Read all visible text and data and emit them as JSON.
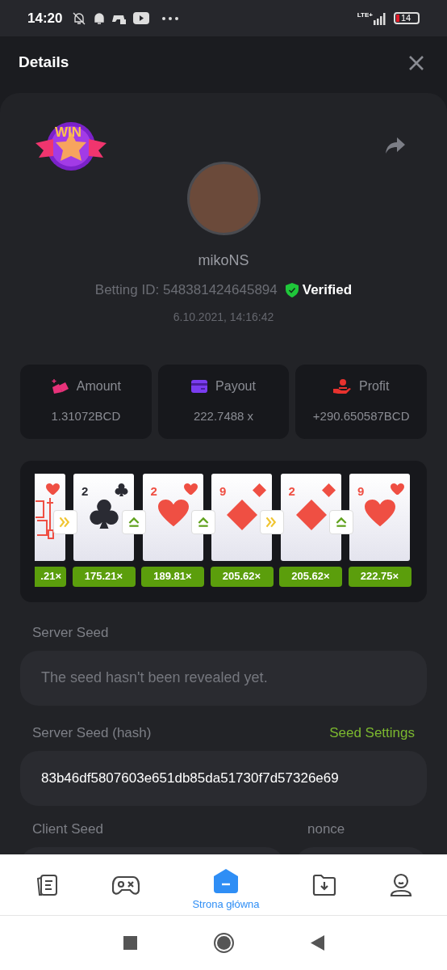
{
  "status_bar": {
    "time": "14:20",
    "network": "LTE+",
    "battery": "14"
  },
  "header": {
    "title": "Details"
  },
  "bet": {
    "username": "mikoNS",
    "betting_id": "Betting ID: 548381424645894",
    "verified": "Verified",
    "date": "6.10.2021, 14:16:42"
  },
  "stats": [
    {
      "kind": "amount",
      "label": "Amount",
      "value": "1.31072BCD"
    },
    {
      "kind": "payout",
      "label": "Payout",
      "value": "222.7488 x"
    },
    {
      "kind": "profit",
      "label": "Profit",
      "value": "+290.650587BCD"
    }
  ],
  "win_badge": {
    "text": "WIN"
  },
  "cards": [
    {
      "kind": "hearts",
      "face": true,
      "multiplier": ".21×"
    },
    {
      "rank": "2",
      "kind": "clubs",
      "multiplier": "175.21×"
    },
    {
      "rank": "2",
      "kind": "hearts",
      "multiplier": "189.81×"
    },
    {
      "rank": "9",
      "kind": "diamonds",
      "multiplier": "205.62×"
    },
    {
      "rank": "2",
      "kind": "diamonds",
      "multiplier": "205.62×"
    },
    {
      "rank": "9",
      "kind": "hearts",
      "multiplier": "222.75×"
    }
  ],
  "steps": [
    {
      "kind": "skip"
    },
    {
      "kind": "higher"
    },
    {
      "kind": "higher"
    },
    {
      "kind": "skip"
    },
    {
      "kind": "higher"
    }
  ],
  "server_seed": {
    "label": "Server Seed",
    "placeholder": "The seed hasn't been revealed yet."
  },
  "server_seed_hash": {
    "label": "Server Seed (hash)",
    "link": "Seed Settings",
    "value": "83b46df5807603e651db85da51730f7d57326e69"
  },
  "client_seed": {
    "label": "Client Seed"
  },
  "nonce": {
    "label": "nonce"
  },
  "bottom_nav": [
    {
      "kind": "cards",
      "selected": false
    },
    {
      "kind": "games",
      "selected": false
    },
    {
      "kind": "home",
      "selected": true,
      "label": "Strona główna"
    },
    {
      "kind": "downloads",
      "selected": false
    },
    {
      "kind": "profile",
      "selected": false
    }
  ]
}
